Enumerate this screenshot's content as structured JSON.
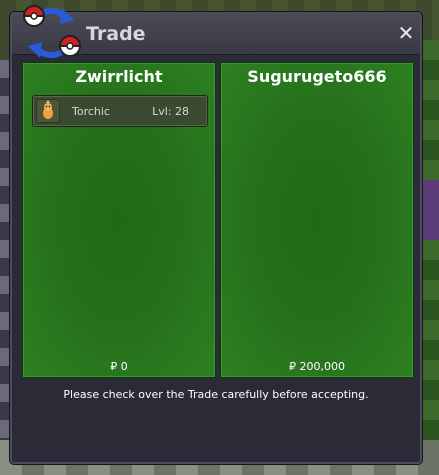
{
  "window": {
    "title": "Trade",
    "close_label": "✕"
  },
  "left_panel": {
    "player_name": "Zwirrlicht",
    "money": "₽ 0",
    "items": [
      {
        "name": "Torchic",
        "level": "Lvl: 28",
        "icon": "torchic-sprite-icon"
      }
    ]
  },
  "right_panel": {
    "player_name": "Sugurugeto666",
    "money": "₽ 200,000",
    "items": []
  },
  "footer": {
    "notice": "Please check over the Trade carefully before accepting."
  },
  "colors": {
    "window_bg": "#2b2b38",
    "panel_green": "#256f1b",
    "title_text": "#d6d6dc"
  }
}
